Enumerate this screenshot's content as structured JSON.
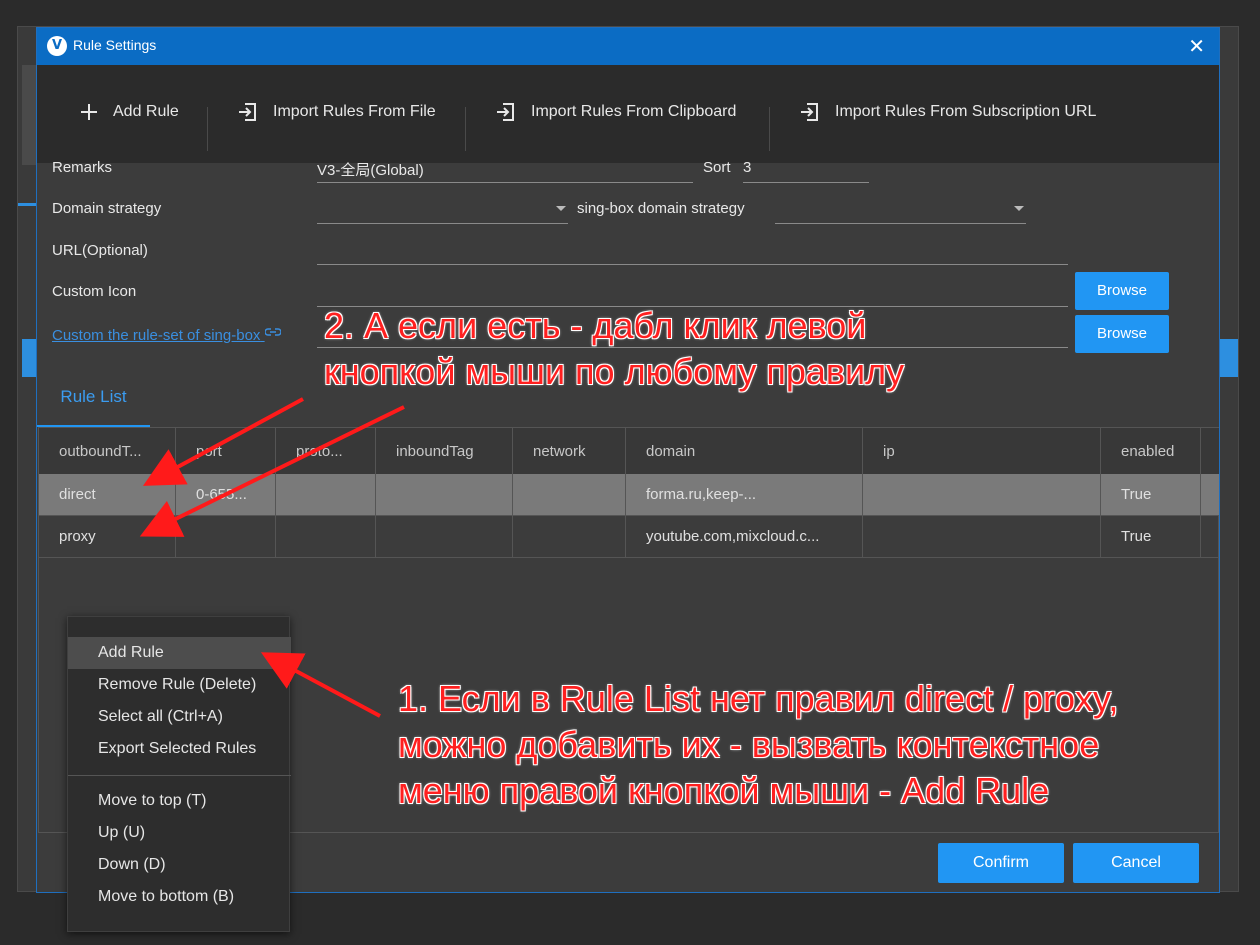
{
  "dialog": {
    "title": "Rule Settings",
    "logo_letter": "V",
    "close_glyph": "✕"
  },
  "toolbar": {
    "add_rule": "Add Rule",
    "import_file": "Import Rules From File",
    "import_clipboard": "Import Rules From Clipboard",
    "import_subscription": "Import Rules From Subscription URL"
  },
  "form": {
    "remarks_label": "Remarks",
    "remarks_value": "V3-全局(Global)",
    "sort_label": "Sort",
    "sort_value": "3",
    "domain_strategy_label": "Domain strategy",
    "domain_strategy_value": "",
    "singbox_strategy_label": "sing-box domain strategy",
    "singbox_strategy_value": "",
    "url_label": "URL(Optional)",
    "url_value": "",
    "custom_icon_label": "Custom Icon",
    "custom_icon_value": "",
    "browse_label": "Browse",
    "ruleset_link": "Custom the rule-set of sing-box",
    "ruleset_value": ""
  },
  "tabs": {
    "rule_list": "Rule List"
  },
  "grid": {
    "columns": [
      "outboundT...",
      "port",
      "proto...",
      "inboundTag",
      "network",
      "domain",
      "ip",
      "enabled"
    ],
    "rows": [
      [
        "direct",
        "0-655...",
        "",
        "",
        "",
        "forma.ru,keep-...",
        "",
        "True"
      ],
      [
        "proxy",
        "",
        "",
        "",
        "",
        "youtube.com,mixcloud.c...",
        "",
        "True"
      ]
    ]
  },
  "buttons": {
    "confirm": "Confirm",
    "cancel": "Cancel"
  },
  "context_menu": {
    "items": [
      "Add Rule",
      "Remove Rule (Delete)",
      "Select all (Ctrl+A)",
      "Export Selected Rules"
    ],
    "items2": [
      "Move to top (T)",
      "Up (U)",
      "Down (D)",
      "Move to bottom (B)"
    ]
  },
  "annotations": {
    "note2_line1": "2. А если есть - дабл клик левой",
    "note2_line2": "кнопкой мыши по любому правилу",
    "note1_line1": "1. Если в Rule List нет правил direct / proxy,",
    "note1_line2": "можно добавить их - вызвать контекстное",
    "note1_line3": "меню правой кнопкой мыши - Add Rule"
  },
  "colors": {
    "accent": "#2196f3",
    "titlebar": "#0b6cc4",
    "annotation": "#ff2020"
  }
}
